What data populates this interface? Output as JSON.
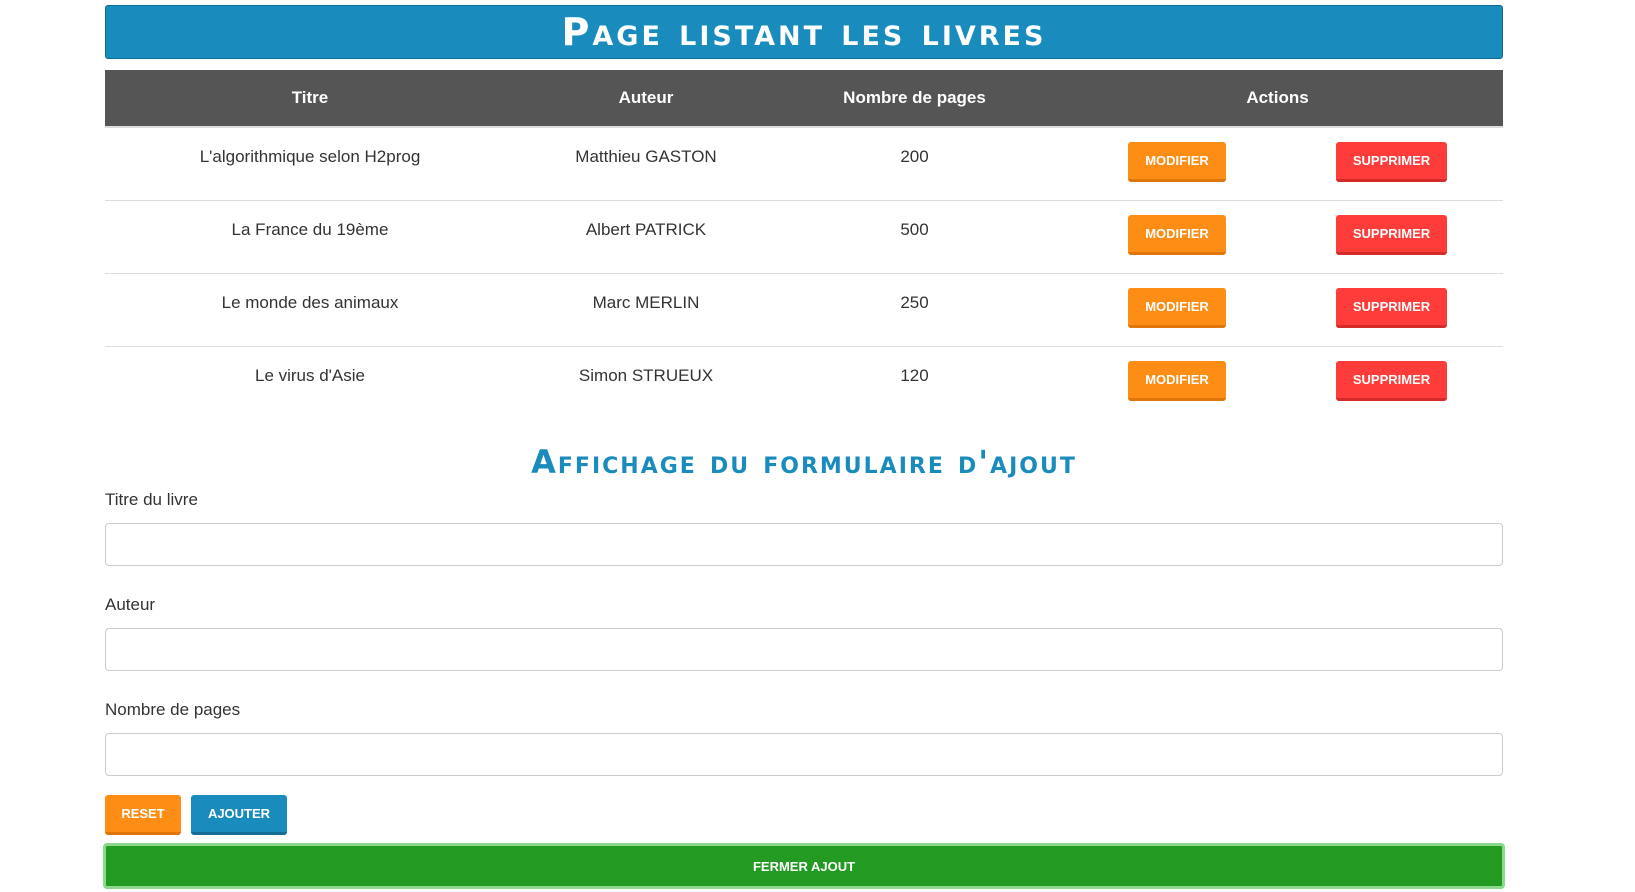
{
  "header": {
    "title": "Page listant les livres"
  },
  "table": {
    "columns": [
      "Titre",
      "Auteur",
      "Nombre de pages",
      "Actions"
    ],
    "rows": [
      {
        "title": "L'algorithmique selon H2prog",
        "author": "Matthieu GASTON",
        "pages": "200"
      },
      {
        "title": "La France du 19ème",
        "author": "Albert PATRICK",
        "pages": "500"
      },
      {
        "title": "Le monde des animaux",
        "author": "Marc MERLIN",
        "pages": "250"
      },
      {
        "title": "Le virus d'Asie",
        "author": "Simon STRUEUX",
        "pages": "120"
      }
    ],
    "modify_label": "Modifier",
    "delete_label": "Supprimer"
  },
  "form": {
    "title": "Affichage du formulaire d'ajout",
    "fields": [
      {
        "label": "Titre du livre",
        "value": "",
        "placeholder": ""
      },
      {
        "label": "Auteur",
        "value": "",
        "placeholder": ""
      },
      {
        "label": "Nombre de pages",
        "value": "",
        "placeholder": ""
      }
    ],
    "reset_label": "Reset",
    "add_label": "Ajouter",
    "close_label": "Fermer ajout"
  },
  "colors": {
    "primary": "#1a8bbd",
    "header_bg": "#555555",
    "orange": "#fd8d14",
    "red": "#fe3c3a",
    "green": "#239b23"
  }
}
